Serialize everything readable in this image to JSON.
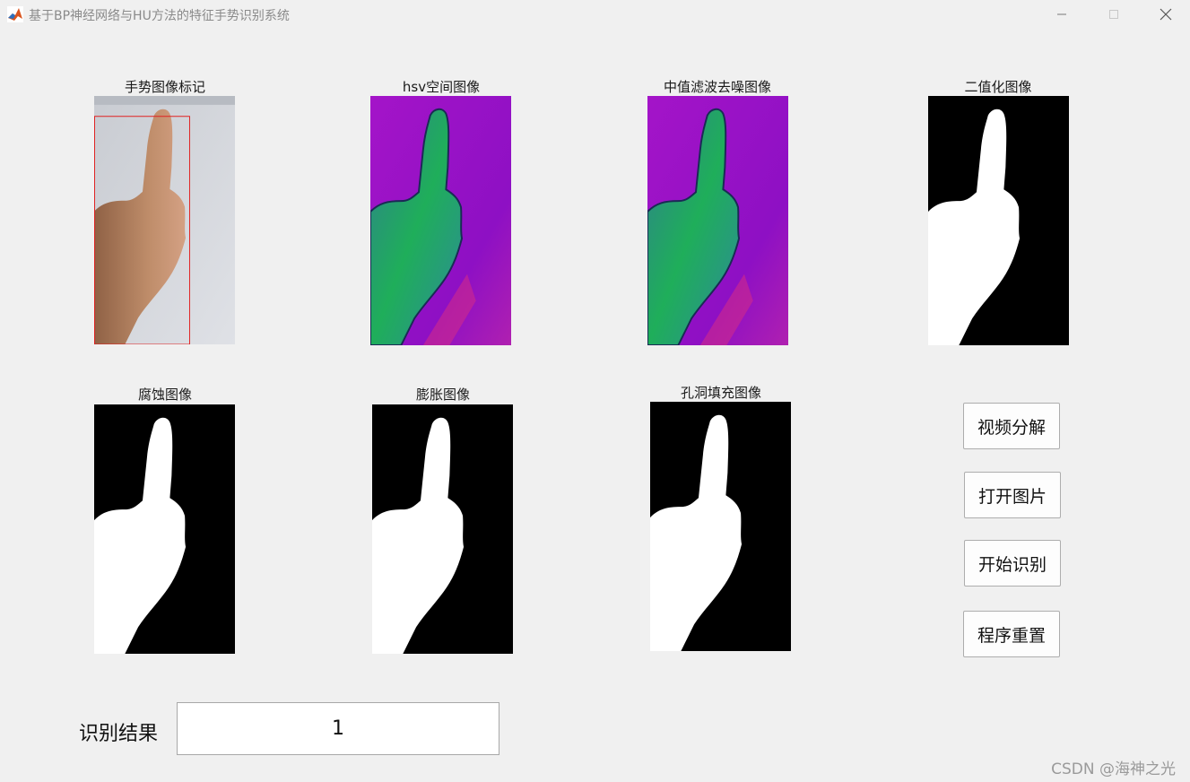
{
  "window": {
    "title": "基于BP神经网络与HU方法的特征手势识别系统",
    "icon": "matlab-logo-icon"
  },
  "panels": {
    "marked": {
      "title": "手势图像标记"
    },
    "hsv": {
      "title": "hsv空间图像"
    },
    "median": {
      "title": "中值滤波去噪图像"
    },
    "binary": {
      "title": "二值化图像"
    },
    "erosion": {
      "title": "腐蚀图像"
    },
    "dilation": {
      "title": "膨胀图像"
    },
    "holefill": {
      "title": "孔洞填充图像"
    }
  },
  "buttons": {
    "video": "视频分解",
    "open": "打开图片",
    "start": "开始识别",
    "reset": "程序重置"
  },
  "result": {
    "label": "识别结果",
    "value": "1"
  },
  "watermark": "CSDN @海神之光",
  "colors": {
    "hsv_bg": "#9a10c8",
    "hand_green": "#2a9a6a",
    "skin": "#b58361"
  }
}
